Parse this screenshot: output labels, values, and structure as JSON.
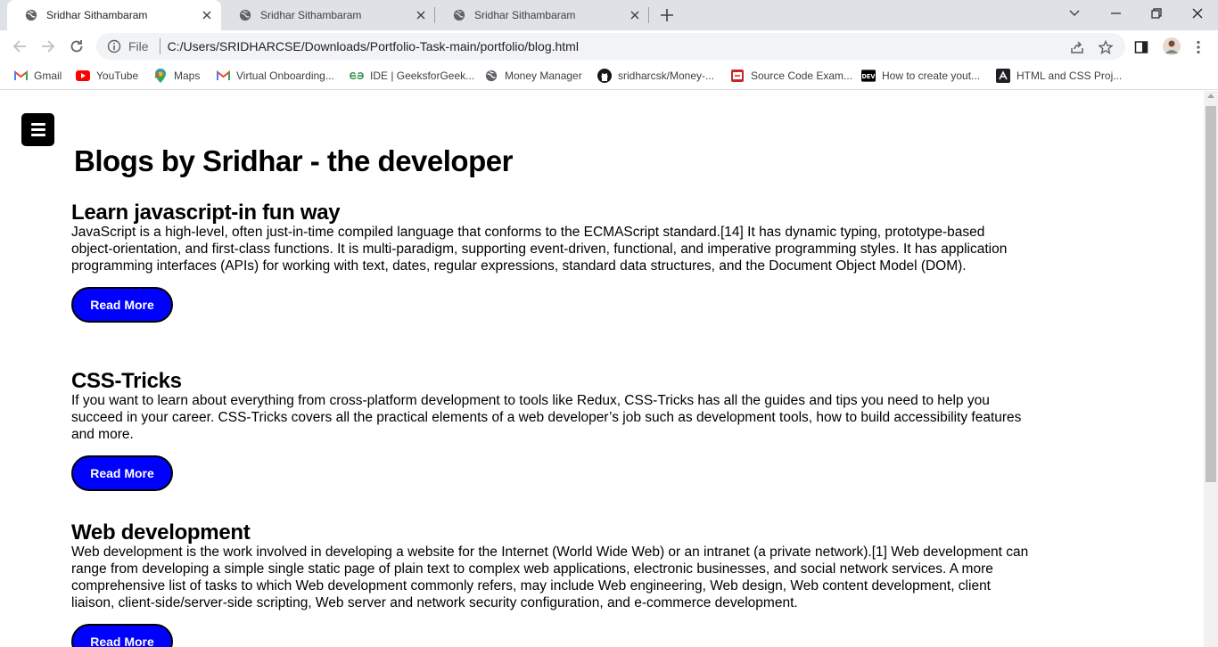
{
  "browser": {
    "tabs": [
      {
        "title": "Sridhar Sithambaram",
        "active": true
      },
      {
        "title": "Sridhar Sithambaram",
        "active": false
      },
      {
        "title": "Sridhar Sithambaram",
        "active": false
      }
    ],
    "new_tab_icon": "plus-icon",
    "window_controls": [
      "chevron-down-icon",
      "minimize-icon",
      "restore-icon",
      "close-icon"
    ],
    "omnibox": {
      "scheme": "File",
      "url": "C:/Users/SRIDHARCSE/Downloads/Portfolio-Task-main/portfolio/blog.html"
    },
    "bookmarks": [
      {
        "label": "Gmail",
        "icon": "gmail-icon"
      },
      {
        "label": "YouTube",
        "icon": "youtube-icon"
      },
      {
        "label": "Maps",
        "icon": "maps-icon"
      },
      {
        "label": "Virtual Onboarding...",
        "icon": "gmail-icon"
      },
      {
        "label": "IDE | GeeksforGeek...",
        "icon": "geeksforgeeks-icon"
      },
      {
        "label": "Money Manager",
        "icon": "globe-icon"
      },
      {
        "label": "sridharcsk/Money-...",
        "icon": "github-icon"
      },
      {
        "label": "Source Code Exam...",
        "icon": "source-code-icon"
      },
      {
        "label": "How to create yout...",
        "icon": "dev-icon"
      },
      {
        "label": "HTML and CSS Proj...",
        "icon": "codepen-icon"
      }
    ]
  },
  "page": {
    "title": "Blogs by Sridhar - the developer",
    "blogs": [
      {
        "heading": "Learn javascript-in fun way",
        "body": "JavaScript is a high-level, often just-in-time compiled language that conforms to the ECMAScript standard.[14] It has dynamic typing, prototype-based object-orientation, and first-class functions. It is multi-paradigm, supporting event-driven, functional, and imperative programming styles. It has application programming interfaces (APIs) for working with text, dates, regular expressions, standard data structures, and the Document Object Model (DOM).",
        "button": "Read More"
      },
      {
        "heading": "CSS-Tricks",
        "body": "If you want to learn about everything from cross-platform development to tools like Redux, CSS-Tricks has all the guides and tips you need to help you succeed in your career. CSS-Tricks covers all the practical elements of a web developer’s job such as development tools, how to build accessibility features and more.",
        "button": "Read More"
      },
      {
        "heading": "Web development",
        "body": "Web development is the work involved in developing a website for the Internet (World Wide Web) or an intranet (a private network).[1] Web development can range from developing a simple single static page of plain text to complex web applications, electronic businesses, and social network services. A more comprehensive list of tasks to which Web development commonly refers, may include Web engineering, Web design, Web content development, client liaison, client-side/server-side scripting, Web server and network security configuration, and e-commerce development.",
        "button": "Read More"
      }
    ]
  },
  "colors": {
    "button_bg": "#0000ff",
    "menu_bg": "#000000",
    "tabstrip_bg": "#dee1e6"
  }
}
